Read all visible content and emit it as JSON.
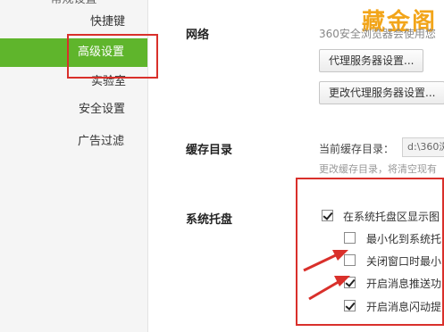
{
  "sidebar": {
    "items": [
      {
        "label": "常规设置"
      },
      {
        "label": "快捷键"
      },
      {
        "label": "高级设置"
      },
      {
        "label": "实验室"
      },
      {
        "label": "安全设置"
      },
      {
        "label": "广告过滤"
      }
    ],
    "active_index": 2
  },
  "network": {
    "title": "网络",
    "description": "360安全浏览器会使用您",
    "proxy_button": "代理服务器设置...",
    "change_proxy_button": "更改代理服务器设置..."
  },
  "cache": {
    "title": "缓存目录",
    "label": "当前缓存目录：",
    "path_value": "d:\\360浏",
    "hint": "更改缓存目录，将清空现有"
  },
  "tray": {
    "title": "系统托盘",
    "options": [
      {
        "label": "在系统托盘区显示图",
        "checked": true
      },
      {
        "label": "最小化到系统托",
        "checked": false
      },
      {
        "label": "关闭窗口时最小",
        "checked": false
      },
      {
        "label": "开启消息推送功",
        "checked": true
      },
      {
        "label": "开启消息闪动提",
        "checked": true
      }
    ]
  },
  "watermark": "藏金阁",
  "colors": {
    "accent_green": "#5fb52c",
    "highlight_red": "#d9302b",
    "watermark_gold": "#f2a51a"
  }
}
